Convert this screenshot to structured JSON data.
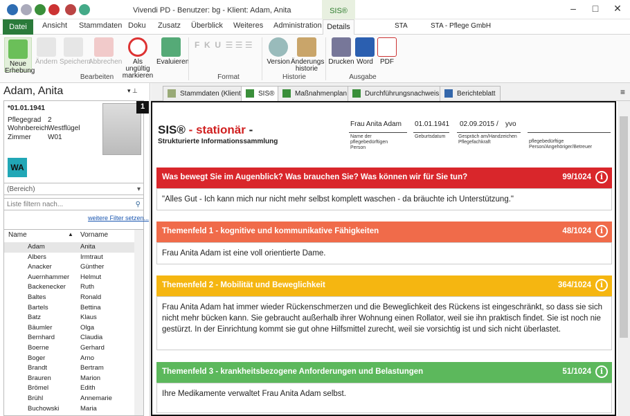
{
  "window": {
    "title": "Vivendi PD - Benutzer: bg - Klient: Adam, Anita",
    "context_tab": "SIS®"
  },
  "menu_tabs": [
    "Datei",
    "Ansicht",
    "Stammdaten",
    "Doku",
    "Zusatz",
    "Überblick",
    "Weiteres",
    "Administration",
    "Details"
  ],
  "sta": {
    "code": "STA",
    "name": "STA - Pflege GmbH"
  },
  "ribbon": {
    "buttons": [
      {
        "label": "Neue Erhebung"
      },
      {
        "label": "Ändern"
      },
      {
        "label": "Speichern"
      },
      {
        "label": "Abbrechen"
      },
      {
        "label": "Als ungültig markieren"
      },
      {
        "label": "Evaluieren"
      },
      {
        "label": "Version"
      },
      {
        "label": "Änderungs historie"
      },
      {
        "label": "Drucken"
      },
      {
        "label": "Word"
      },
      {
        "label": "PDF"
      }
    ],
    "groups": [
      "Bearbeiten",
      "Format",
      "Historie",
      "Ausgabe"
    ]
  },
  "client": {
    "name": "Adam, Anita",
    "birth": "*01.01.1941",
    "pflegegrad_label": "Pflegegrad",
    "pflegegrad": "2",
    "wohnbereich_label": "Wohnbereich",
    "wohnbereich": "Westflügel",
    "zimmer_label": "Zimmer",
    "zimmer": "W01",
    "badge": "WA"
  },
  "filter": {
    "bereich": "(Bereich)",
    "placeholder": "Liste filtern nach...",
    "link": "weitere Filter setzen..."
  },
  "list": {
    "col_name": "Name",
    "col_vorname": "Vorname",
    "rows": [
      [
        "Adam",
        "Anita"
      ],
      [
        "Albers",
        "Irmtraut"
      ],
      [
        "Anacker",
        "Günther"
      ],
      [
        "Auernhammer",
        "Helmut"
      ],
      [
        "Backenecker",
        "Ruth"
      ],
      [
        "Baltes",
        "Ronald"
      ],
      [
        "Bartels",
        "Bettina"
      ],
      [
        "Batz",
        "Klaus"
      ],
      [
        "Bäumler",
        "Olga"
      ],
      [
        "Bernhard",
        "Claudia"
      ],
      [
        "Boerne",
        "Gerhard"
      ],
      [
        "Boger",
        "Arno"
      ],
      [
        "Brandt",
        "Bertram"
      ],
      [
        "Brauren",
        "Marion"
      ],
      [
        "Brömel",
        "Edith"
      ],
      [
        "Brühl",
        "Annemarie"
      ],
      [
        "Buchowski",
        "Maria"
      ]
    ]
  },
  "doc_tabs": [
    "Stammdaten (Klient)",
    "SIS®",
    "Maßnahmenplan",
    "Durchführungsnachweis",
    "Berichteblatt"
  ],
  "marker": "1",
  "sis": {
    "title_a": "SIS®",
    "title_b": "stationär",
    "title_c": "-",
    "title_dash": "-",
    "subtitle": "Strukturierte Informationssammlung",
    "person": "Frau Anita Adam",
    "person_lbl": "Name der pflegebedürftigen Person",
    "birth": "01.01.1941",
    "birth_lbl": "Geburtsdatum",
    "date": "02.09.2015",
    "slash": "/",
    "sign": "yvo",
    "date_lbl": "Gespräch am/Handzeichen Pflegefachkraft",
    "rep_lbl": "pflegebedürftige Person/Angehöriger/Betreuer",
    "sections": [
      {
        "title": "Was bewegt Sie im Augenblick? Was brauchen Sie? Was können wir für Sie tun?",
        "count": "99/1024",
        "color": "#d9262b",
        "text": "\"Alles Gut - Ich kann mich nur nicht mehr selbst komplett waschen - da bräuchte ich Unterstützung.\""
      },
      {
        "title": "Themenfeld 1 - kognitive und kommunikative Fähigkeiten",
        "count": "48/1024",
        "color": "#f06b4a",
        "text": "Frau Anita Adam ist eine voll orientierte Dame."
      },
      {
        "title": "Themenfeld 2 - Mobilität und Beweglichkeit",
        "count": "364/1024",
        "color": "#f5b611",
        "text": "Frau Anita Adam hat immer wieder Rückenschmerzen und die Beweglichkeit des Rückens ist eingeschränkt, so dass sie sich nicht mehr bücken kann. Sie gebraucht außerhalb ihrer Wohnung einen Rollator, weil sie ihn praktisch findet. Sie ist noch nie gestürzt. In der Einrichtung kommt sie gut ohne Hilfsmittel zurecht, weil sie vorsichtig ist und sich nicht überlastet."
      },
      {
        "title": "Themenfeld 3 - krankheitsbezogene Anforderungen und Belastungen",
        "count": "51/1024",
        "color": "#5cb85c",
        "text": "Ihre Medikamente verwaltet Frau Anita Adam selbst."
      }
    ]
  }
}
